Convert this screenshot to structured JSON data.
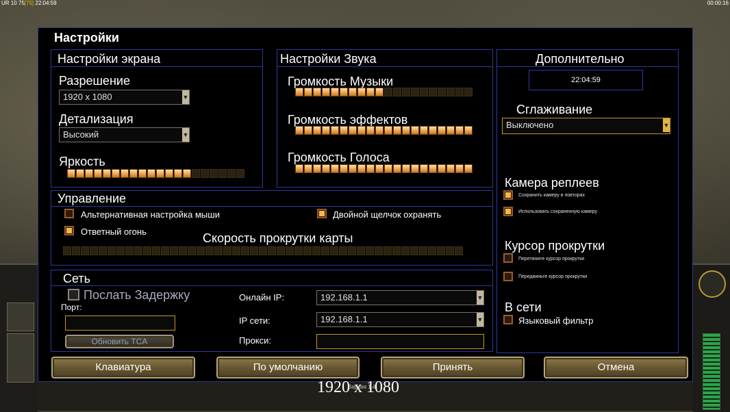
{
  "topbar": {
    "left_prefix": "UR 10 75",
    "left_bracket": "[75]",
    "left_time": "22:04:59",
    "right_time": "00:00:16"
  },
  "title": "Настройки",
  "screen": {
    "header": "Настройки экрана",
    "resolution_label": "Разрешение",
    "resolution_value": "1920 x 1080",
    "detail_label": "Детализация",
    "detail_value": "Высокий",
    "brightness_label": "Яркость",
    "brightness_level": 0.7
  },
  "sound": {
    "header": "Настройки Звука",
    "music_label": "Громкость Музыки",
    "music_level": 0.5,
    "effects_label": "Громкость эффектов",
    "effects_level": 1.0,
    "voice_label": "Громкость Голоса",
    "voice_level": 1.0
  },
  "extra": {
    "header": "Дополнительно",
    "clock": "22:04:59",
    "aa_label": "Сглаживание",
    "aa_value": "Выключено",
    "replay_header": "Камера реплеев",
    "replay_save": "Сохранить камеру в повторах",
    "replay_use": "Использовать сохраненную камеру",
    "cursor_header": "Курсор прокрутки",
    "cursor_drag": "Перетяните курсор прокрутки",
    "cursor_move": "Передвиньте курсор прокрутки",
    "online_header": "В сети",
    "lang_filter": "Языковый фильтр"
  },
  "control": {
    "header": "Управление",
    "alt_mouse": "Альтернативная настройка мыши",
    "double_click": "Двойной щелчок охранять",
    "return_fire": "Ответный огонь",
    "scroll_label": "Скорость прокрутки карты",
    "scroll_level": 0.0
  },
  "network": {
    "header": "Сеть",
    "send_latency": "Послать Задержку",
    "port_label": "Порт:",
    "update_button": "Обновить TCA",
    "online_ip_label": "Онлайн IP:",
    "online_ip_value": "192.168.1.1",
    "lan_ip_label": "IP сети:",
    "lan_ip_value": "192.168.1.1",
    "proxy_label": "Прокси:"
  },
  "buttons": {
    "keyboard": "Клавиатура",
    "defaults": "По умолчанию",
    "accept": "Принять",
    "cancel": "Отмена"
  },
  "overlay_text": "1920 x 1080",
  "version_text": "Версия 1.4",
  "colors": {
    "accent": "#e8a14a",
    "border": "#2c3aa0",
    "gold": "#c8962a"
  }
}
